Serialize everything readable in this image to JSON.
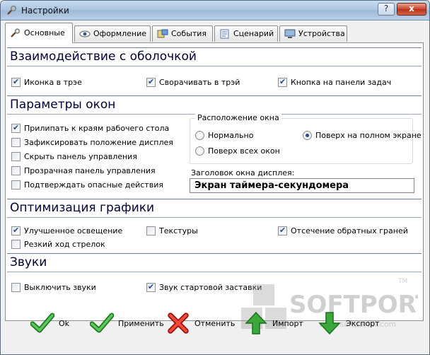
{
  "window": {
    "title": "Настройки",
    "help_label": "?",
    "close_label": "x"
  },
  "tabs": [
    {
      "label": "Основные",
      "active": true,
      "icon": "wrench-icon"
    },
    {
      "label": "Оформление",
      "active": false,
      "icon": "eye-icon"
    },
    {
      "label": "События",
      "active": false,
      "icon": "events-icon"
    },
    {
      "label": "Сценарий",
      "active": false,
      "icon": "script-icon"
    },
    {
      "label": "Устройства",
      "active": false,
      "icon": "devices-icon"
    }
  ],
  "sections": {
    "shell": {
      "title": "Взаимодействие с оболочкой",
      "options": [
        {
          "label": "Иконка в трэе",
          "checked": true
        },
        {
          "label": "Сворачивать в трэй",
          "checked": true
        },
        {
          "label": "Кнопка на панели задач",
          "checked": true
        }
      ]
    },
    "window_params": {
      "title": "Параметры окон",
      "options": [
        {
          "label": "Прилипать к краям рабочего стола",
          "checked": true
        },
        {
          "label": "Зафиксировать положение дисплея",
          "checked": false
        },
        {
          "label": "Скрыть панель управления",
          "checked": false
        },
        {
          "label": "Прозрачная панель управления",
          "checked": false
        },
        {
          "label": "Подтверждать опасные действия",
          "checked": false
        }
      ],
      "position_group": {
        "title": "Расположение окна",
        "options": [
          {
            "label": "Нормально",
            "selected": false
          },
          {
            "label": "Поверх на полном экране",
            "selected": true
          },
          {
            "label": "Поверх всех окон",
            "selected": false
          }
        ]
      },
      "display_title_label": "Заголовок окна дисплея:",
      "display_title_value": "Экран таймера-секундомера"
    },
    "graphics": {
      "title": "Оптимизация графики",
      "options": [
        {
          "label": "Улучшенное освещение",
          "checked": true
        },
        {
          "label": "Текстуры",
          "checked": false
        },
        {
          "label": "Отсечение обратных граней",
          "checked": true
        },
        {
          "label": "Резкий ход стрелок",
          "checked": false
        }
      ]
    },
    "sounds": {
      "title": "Звуки",
      "options": [
        {
          "label": "Выключить звуки",
          "checked": false
        },
        {
          "label": "Звук стартовой заставки",
          "checked": true
        }
      ]
    }
  },
  "footer": {
    "ok_label": "Ok",
    "apply_label": "Применить",
    "cancel_label": "Отменить",
    "import_label": "Импорт",
    "export_label": "Экспорт"
  },
  "watermark": {
    "text": "SOFTPORTAL",
    "url": "www.softportal.com",
    "mark": "TM"
  },
  "colors": {
    "accent_green": "#2f9e2f",
    "cancel_red": "#d62020",
    "checkmark": "#2b4c8a"
  }
}
